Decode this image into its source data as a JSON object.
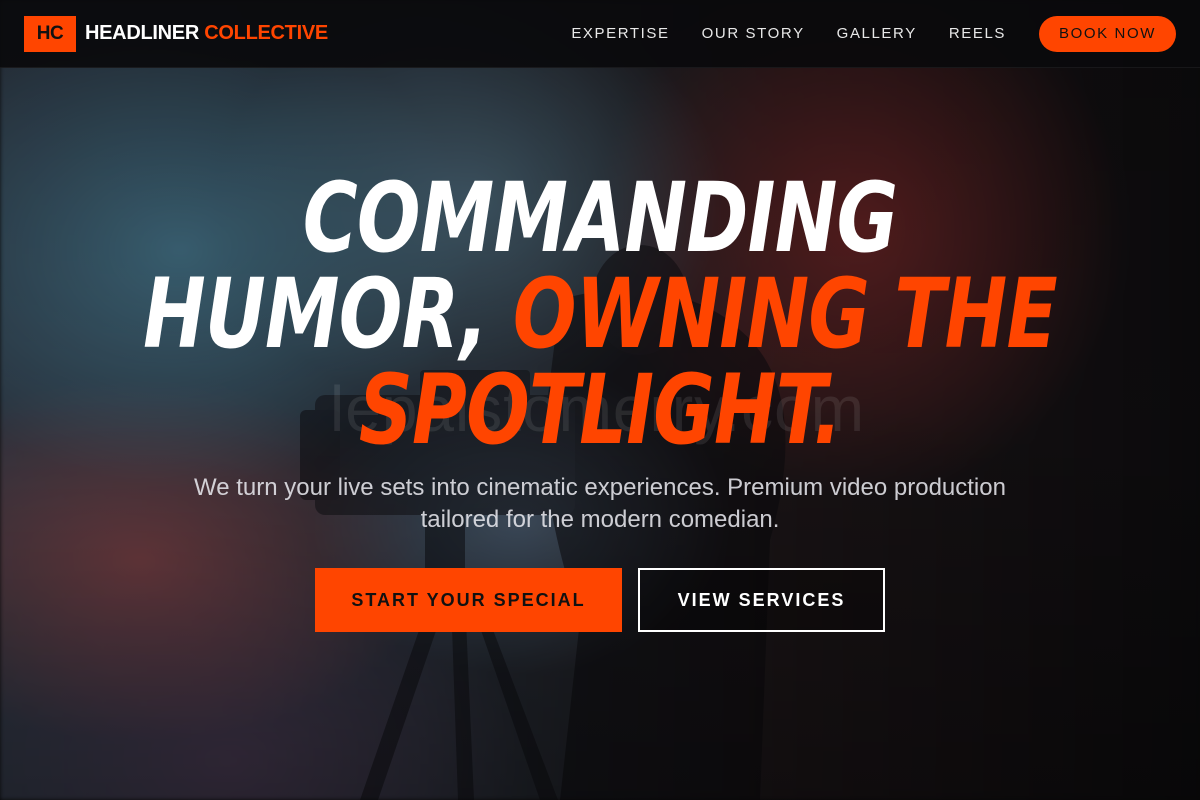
{
  "brand": {
    "mark": "HC",
    "name_white": "HEADLINER",
    "name_accent": "COLLECTIVE"
  },
  "nav": {
    "links": [
      "EXPERTISE",
      "OUR STORY",
      "GALLERY",
      "REELS"
    ],
    "cta": "BOOK NOW"
  },
  "hero": {
    "headline": {
      "line1": "COMMANDING",
      "line2_white": "HUMOR,",
      "line2_accent": "OWNING THE",
      "line3_accent": "SPOTLIGHT."
    },
    "subtitle": "We turn your live sets into cinematic experiences. Premium video production tailored for the modern comedian.",
    "primary_cta": "START YOUR SPECIAL",
    "secondary_cta": "VIEW SERVICES",
    "watermark": "lepaistomerry.com",
    "background_icon": "camera-operator-silhouette"
  },
  "colors": {
    "accent": "#ff4500",
    "navbar_bg": "#0a0a0c",
    "text": "#ffffff"
  }
}
